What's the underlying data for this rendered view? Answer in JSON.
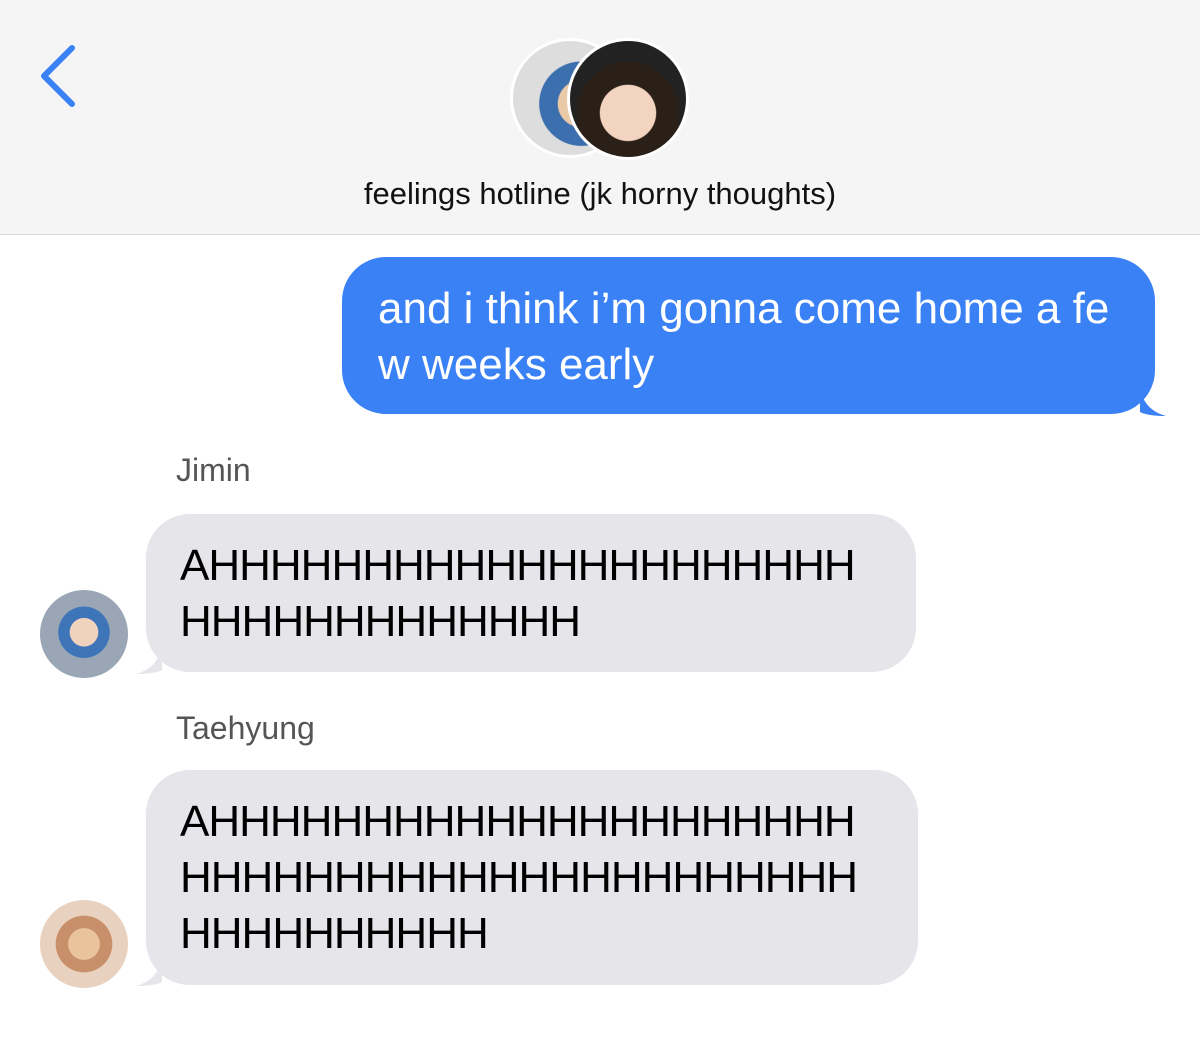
{
  "header": {
    "title": "feelings hotline (jk horny thoughts)",
    "back_icon": "chevron-left-icon"
  },
  "colors": {
    "accent": "#3a81f6",
    "incoming": "#e5e5ea"
  },
  "messages": [
    {
      "sender": "me",
      "text": "and i think i’m gonna come home a few weeks early"
    },
    {
      "sender": "Jimin",
      "text": "AHHHHHHHHHHHHHHHHHHHHHHHHHHHHHHHHHH"
    },
    {
      "sender": "Taehyung",
      "text": "AHHHHHHHHHHHHHHHHHHHHHHHHHHHHHHHHHHHHHHHHHHHHHHHHHHHHH"
    }
  ]
}
